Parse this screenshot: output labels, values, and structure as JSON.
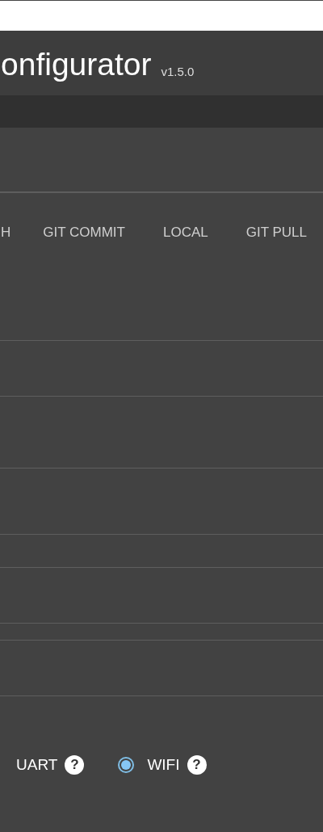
{
  "header": {
    "title": "onfigurator",
    "version": "v1.5.0"
  },
  "table": {
    "columns": [
      {
        "label": "H"
      },
      {
        "label": "GIT COMMIT"
      },
      {
        "label": "LOCAL"
      },
      {
        "label": "GIT PULL"
      }
    ]
  },
  "connection": {
    "options": [
      {
        "label": "UART",
        "help": "?"
      },
      {
        "label": "WIFI",
        "help": "?",
        "selected": true
      }
    ]
  }
}
